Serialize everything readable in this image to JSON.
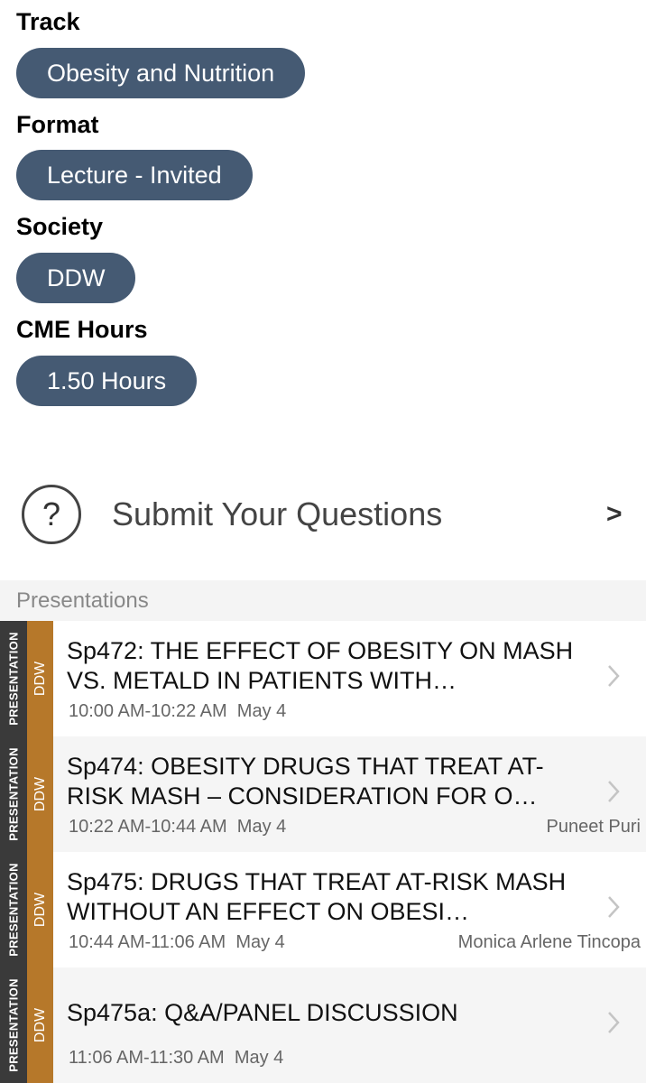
{
  "attributes": {
    "track": {
      "heading": "Track",
      "value": "Obesity and Nutrition"
    },
    "format": {
      "heading": "Format",
      "value": "Lecture - Invited"
    },
    "society": {
      "heading": "Society",
      "value": "DDW"
    },
    "cme": {
      "heading": "CME Hours",
      "value": "1.50 Hours"
    }
  },
  "submit": {
    "icon": "question-circle-icon",
    "label": "Submit Your Questions",
    "chevron": ">"
  },
  "presentations": {
    "header": "Presentations",
    "items": [
      {
        "type": "PRESENTATION",
        "society": "DDW",
        "title": "Sp472: THE EFFECT OF OBESITY ON MASH VS. METALD IN PATIENTS WITH…",
        "time": "10:00 AM-10:22 AM",
        "date": "May 4",
        "speaker": ""
      },
      {
        "type": "PRESENTATION",
        "society": "DDW",
        "title": "Sp474: OBESITY DRUGS THAT TREAT AT-RISK MASH – CONSIDERATION FOR O…",
        "time": "10:22 AM-10:44 AM",
        "date": "May 4",
        "speaker": "Puneet Puri"
      },
      {
        "type": "PRESENTATION",
        "society": "DDW",
        "title": "Sp475: DRUGS THAT TREAT AT-RISK MASH WITHOUT AN EFFECT ON OBESI…",
        "time": "10:44 AM-11:06 AM",
        "date": "May 4",
        "speaker": "Monica Arlene Tincopa"
      },
      {
        "type": "PRESENTATION",
        "society": "DDW",
        "title": "Sp475a: Q&A/PANEL DISCUSSION",
        "time": "11:06 AM-11:30 AM",
        "date": "May 4",
        "speaker": ""
      }
    ]
  },
  "colors": {
    "pill": "#455a73",
    "society_strip": "#b6782a",
    "type_strip": "#3a3a3a"
  }
}
